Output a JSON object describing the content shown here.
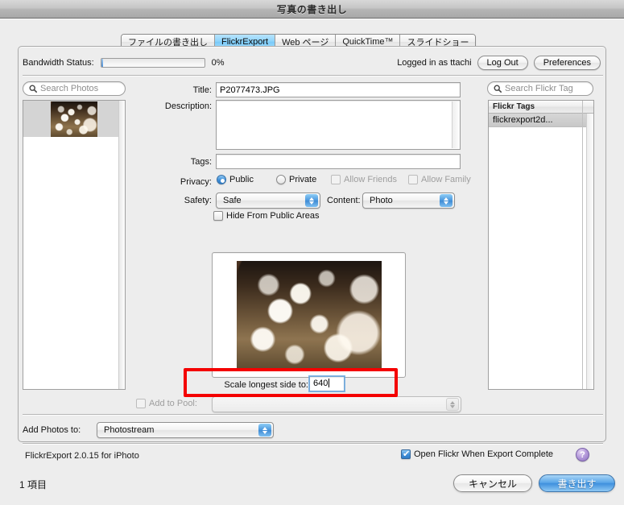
{
  "window": {
    "title": "写真の書き出し"
  },
  "tabs": [
    {
      "label": "ファイルの書き出し",
      "active": false
    },
    {
      "label": "FlickrExport",
      "active": true
    },
    {
      "label": "Web ページ",
      "active": false
    },
    {
      "label": "QuickTime™",
      "active": false
    },
    {
      "label": "スライドショー",
      "active": false
    }
  ],
  "bandwidth": {
    "label": "Bandwidth Status:",
    "percent_label": "0%",
    "percent_value": 0
  },
  "account": {
    "logged_in_text": "Logged in as ttachi",
    "logout_label": "Log Out",
    "preferences_label": "Preferences"
  },
  "photo_browser": {
    "search_placeholder": "Search Photos",
    "search_icon": "search-icon",
    "item_count": 1
  },
  "form": {
    "title_label": "Title:",
    "title_value": "P2077473.JPG",
    "description_label": "Description:",
    "description_value": "",
    "tags_label": "Tags:",
    "tags_value": "",
    "privacy_label": "Privacy:",
    "privacy_public_label": "Public",
    "privacy_private_label": "Private",
    "privacy_selected": "Public",
    "allow_friends_label": "Allow Friends",
    "allow_friends_checked": false,
    "allow_friends_enabled": false,
    "allow_family_label": "Allow Family",
    "allow_family_checked": false,
    "allow_family_enabled": false,
    "safety_label": "Safety:",
    "safety_value": "Safe",
    "content_label": "Content:",
    "content_value": "Photo",
    "hide_public_label": "Hide From Public Areas",
    "hide_public_checked": false
  },
  "scale": {
    "label": "Scale longest side to:",
    "value": "640",
    "highlight_color": "#f40000"
  },
  "pool": {
    "label": "Add to Pool:",
    "checked": false,
    "enabled": false,
    "value": ""
  },
  "add_photos": {
    "label": "Add Photos to:",
    "value": "Photostream"
  },
  "flickr_tags": {
    "search_placeholder": "Search Flickr Tag",
    "search_icon": "search-icon",
    "column_header": "Flickr Tags",
    "rows": [
      {
        "label": "flickrexport2d..."
      }
    ]
  },
  "footer": {
    "version_text": "FlickrExport 2.0.15 for iPhoto",
    "open_flickr_label": "Open Flickr When Export Complete",
    "open_flickr_checked": true,
    "help_label": "?"
  },
  "bottom_bar": {
    "item_count_label": "1 項目",
    "cancel_label": "キャンセル",
    "export_label": "書き出す"
  }
}
